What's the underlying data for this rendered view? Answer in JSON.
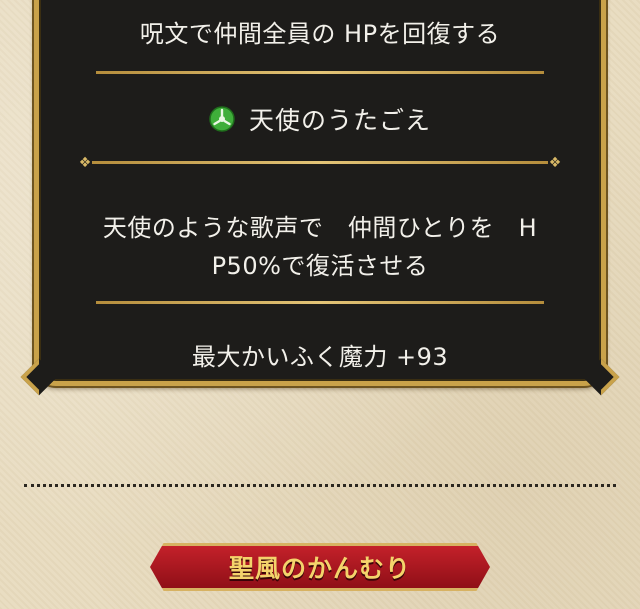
{
  "panel": {
    "top_description": "呪文で仲間全員の HPを回復する",
    "spell_name": "天使のうたごえ",
    "spell_description_line1": "天使のような歌声で　仲間ひとりを　H",
    "spell_description_line2": "P50%で復活させる",
    "max_heal_power": "最大かいふく魔力 +93"
  },
  "item_banner": {
    "label": "聖風のかんむり"
  },
  "icons": {
    "spell_icon": "green-orb-icon",
    "ornament_left": "fleur-ornament-icon",
    "ornament_right": "fleur-ornament-icon"
  },
  "colors": {
    "panel_bg": "#1d1c1a",
    "gold": "#c9a24a",
    "parchment": "#e8dcc0",
    "banner_red": "#c4212a",
    "banner_text": "#f4d36b",
    "spell_icon_green": "#3fae3a"
  }
}
